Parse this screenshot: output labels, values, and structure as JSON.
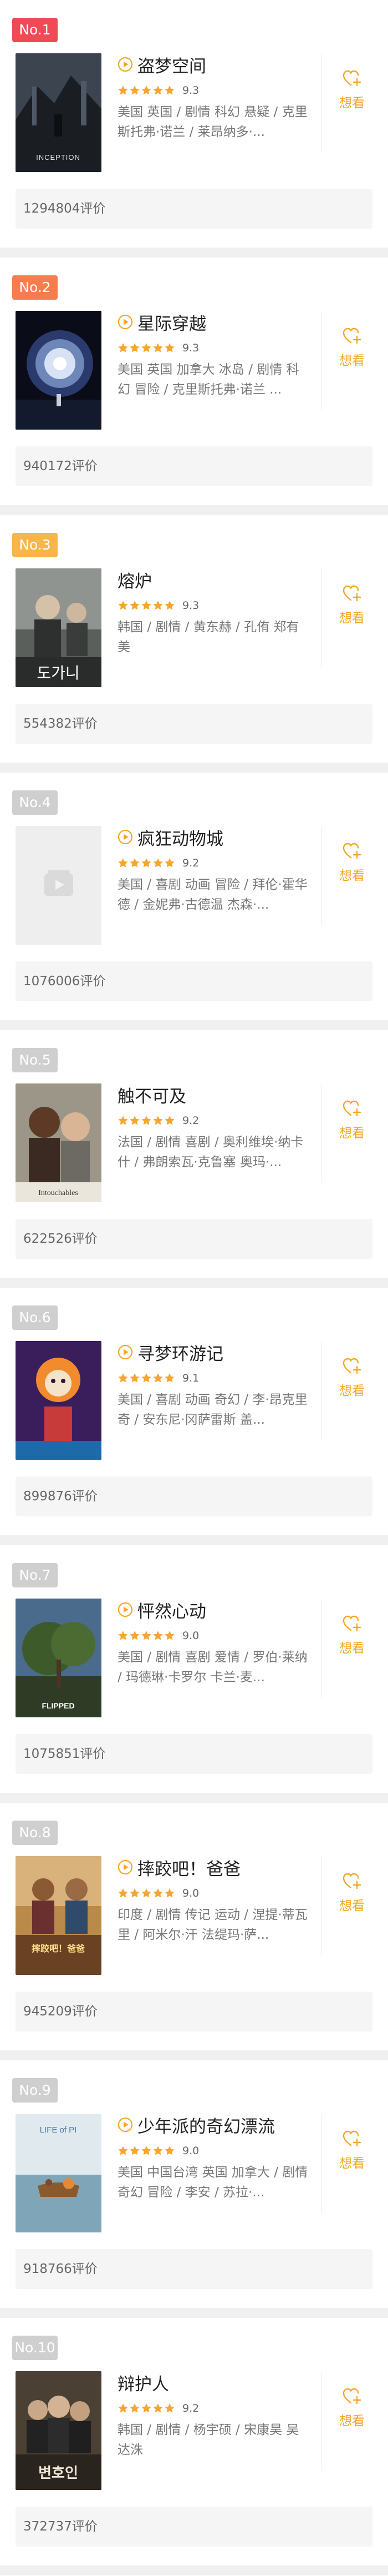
{
  "labels": {
    "want": "想看"
  },
  "colors": {
    "rank_top": [
      "#ee4b57",
      "#f87d4e",
      "#f7b64a"
    ],
    "rank_other": "#cfcfcf",
    "accent": "#f5a623",
    "star": "#f7a531"
  },
  "movies": [
    {
      "rank": "No.1",
      "title": "盗梦空间",
      "score": "9.3",
      "rating": 9.3,
      "has_play": true,
      "meta": "美国 英国 / 剧情 科幻 悬疑 / 克里斯托弗·诺兰 / 莱昂纳多·...",
      "reviews": "1294804评价",
      "poster": {
        "style": "inception",
        "text": "INCEPTION"
      }
    },
    {
      "rank": "No.2",
      "title": "星际穿越",
      "score": "9.3",
      "rating": 9.3,
      "has_play": true,
      "meta": "美国 英国 加拿大 冰岛 / 剧情 科幻 冒险 / 克里斯托弗·诺兰 ...",
      "reviews": "940172评价",
      "poster": {
        "style": "interstellar",
        "text": ""
      }
    },
    {
      "rank": "No.3",
      "title": "熔炉",
      "score": "9.3",
      "rating": 9.3,
      "has_play": false,
      "meta": "韩国 / 剧情 / 黄东赫 / 孔侑 郑有美",
      "reviews": "554382评价",
      "poster": {
        "style": "silenced",
        "text": "도가니"
      }
    },
    {
      "rank": "No.4",
      "title": "疯狂动物城",
      "score": "9.2",
      "rating": 9.2,
      "has_play": true,
      "meta": "美国 / 喜剧 动画 冒险 / 拜伦·霍华德 / 金妮弗·古德温 杰森·...",
      "reviews": "1076006评价",
      "poster": {
        "style": "placeholder",
        "text": ""
      }
    },
    {
      "rank": "No.5",
      "title": "触不可及",
      "score": "9.2",
      "rating": 9.2,
      "has_play": false,
      "meta": "法国 / 剧情 喜剧 / 奥利维埃·纳卡什 / 弗朗索瓦·克鲁塞 奥玛·...",
      "reviews": "622526评价",
      "poster": {
        "style": "intouchables",
        "text": "Intouchables"
      }
    },
    {
      "rank": "No.6",
      "title": "寻梦环游记",
      "score": "9.1",
      "rating": 9.1,
      "has_play": true,
      "meta": "美国 / 喜剧 动画 奇幻 / 李·昂克里奇 / 安东尼·冈萨雷斯 盖...",
      "reviews": "899876评价",
      "poster": {
        "style": "coco",
        "text": ""
      }
    },
    {
      "rank": "No.7",
      "title": "怦然心动",
      "score": "9.0",
      "rating": 9.0,
      "has_play": true,
      "meta": "美国 / 剧情 喜剧 爱情 / 罗伯·莱纳 / 玛德琳·卡罗尔 卡兰·麦...",
      "reviews": "1075851评价",
      "poster": {
        "style": "flipped",
        "text": "FLIPPED"
      }
    },
    {
      "rank": "No.8",
      "title": "摔跤吧！爸爸",
      "score": "9.0",
      "rating": 9.0,
      "has_play": true,
      "meta": "印度 / 剧情 传记 运动 / 涅提·蒂瓦里 / 阿米尔·汗 法缇玛·萨...",
      "reviews": "945209评价",
      "poster": {
        "style": "dangal",
        "text": "摔跤吧！爸爸"
      }
    },
    {
      "rank": "No.9",
      "title": "少年派的奇幻漂流",
      "score": "9.0",
      "rating": 9.0,
      "has_play": true,
      "meta": "美国 中国台湾 英国 加拿大 / 剧情 奇幻 冒险 / 李安 / 苏拉·...",
      "reviews": "918766评价",
      "poster": {
        "style": "lifeofpi",
        "text": "LIFE of PI"
      }
    },
    {
      "rank": "No.10",
      "title": "辩护人",
      "score": "9.2",
      "rating": 9.2,
      "has_play": false,
      "meta": "韩国 / 剧情 / 杨宇硕 / 宋康昊 吴达洙",
      "reviews": "372737评价",
      "poster": {
        "style": "attorney",
        "text": "변호인"
      }
    }
  ]
}
